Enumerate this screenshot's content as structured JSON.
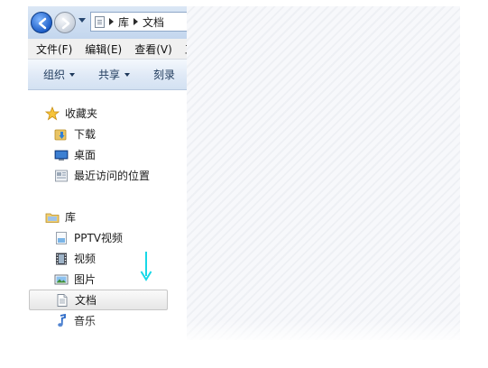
{
  "address": {
    "path": [
      "库",
      "文档"
    ]
  },
  "menu": {
    "items": [
      "文件(F)",
      "编辑(E)",
      "查看(V)",
      "工"
    ]
  },
  "commandbar": {
    "items": [
      {
        "label": "组织",
        "has_caret": true
      },
      {
        "label": "共享",
        "has_caret": true
      },
      {
        "label": "刻录",
        "has_caret": false
      }
    ]
  },
  "navigation": {
    "favorites_label": "收藏夹",
    "favorites": [
      "下载",
      "桌面",
      "最近访问的位置"
    ],
    "library_label": "库",
    "library": [
      "PPTV视频",
      "视频",
      "图片",
      "文档",
      "音乐"
    ],
    "selected": "文档"
  },
  "annotation": {
    "arrow_color": "#17d8e8"
  },
  "colors": {
    "accent": "#1f5fc8",
    "selected_bg": "#e6e6e6"
  }
}
